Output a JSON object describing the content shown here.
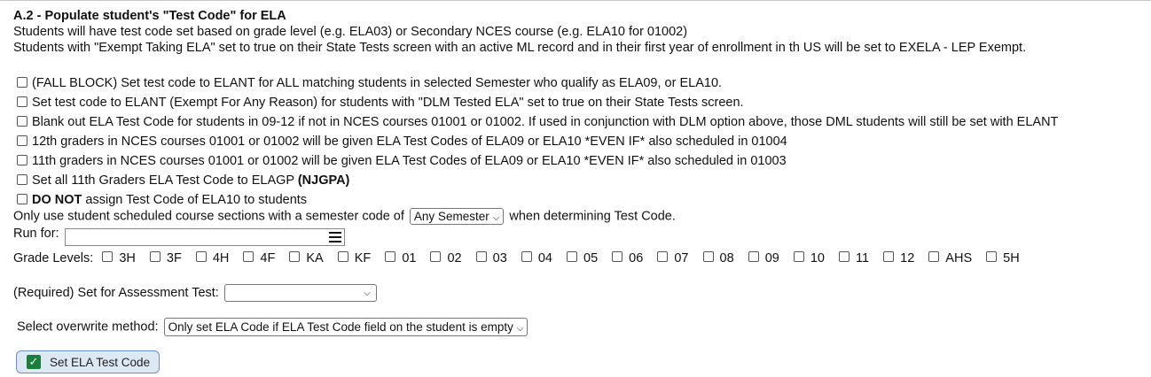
{
  "section": {
    "title": "A.2 - Populate student's \"Test Code\" for ELA",
    "desc1": "Students will have test code set based on grade level (e.g. ELA03) or Secondary NCES course (e.g. ELA10 for 01002)",
    "desc2": "Students with \"Exempt Taking ELA\" set to true on their State Tests screen with an active ML record and in their first year of enrollment in th US will be set to EXELA - LEP Exempt."
  },
  "options": [
    {
      "text": "(FALL BLOCK) Set test code to ELANT for ALL matching students in selected Semester who qualify as ELA09, or ELA10.",
      "checked": false
    },
    {
      "text": "Set test code to ELANT (Exempt For Any Reason) for students with \"DLM Tested ELA\" set to true on their State Tests screen.",
      "checked": false
    },
    {
      "text": "Blank out ELA Test Code for students in 09-12 if not in NCES courses 01001 or 01002. If used in conjunction with DLM option above, those DML students will still be set with ELANT",
      "checked": false
    },
    {
      "text": "12th graders in NCES courses 01001 or 01002 will be given ELA Test Codes of ELA09 or ELA10 *EVEN IF* also scheduled in 01004",
      "checked": false
    },
    {
      "text": "11th graders in NCES courses 01001 or 01002 will be given ELA Test Codes of ELA09 or ELA10 *EVEN IF* also scheduled in 01003",
      "checked": false
    },
    {
      "text": "Set all 11th Graders ELA Test Code to ELAGP ",
      "bold_suffix": "(NJGPA)",
      "checked": false
    },
    {
      "bold_prefix": "DO NOT",
      "text": " assign Test Code of ELA10 to students",
      "checked": false
    }
  ],
  "semester": {
    "prefix": "Only use student scheduled course sections with a semester code of",
    "selected": "Any Semester",
    "suffix": "when determining Test Code."
  },
  "run_for": {
    "label": "Run for:",
    "value": ""
  },
  "grade_levels": {
    "label": "Grade Levels:",
    "items": [
      "3H",
      "3F",
      "4H",
      "4F",
      "KA",
      "KF",
      "01",
      "02",
      "03",
      "04",
      "05",
      "06",
      "07",
      "08",
      "09",
      "10",
      "11",
      "12",
      "AHS",
      "5H"
    ]
  },
  "assessment": {
    "label": "(Required) Set for Assessment Test:",
    "selected": ""
  },
  "overwrite": {
    "label": "Select overwrite method:",
    "selected": "Only set ELA Code if ELA Test Code field on the student is empty"
  },
  "submit": {
    "label": "Set ELA Test Code"
  },
  "icons": {
    "submit": "checkmark-icon",
    "run_for_menu": "hamburger-menu-icon",
    "dropdown": "chevron-down-icon"
  }
}
